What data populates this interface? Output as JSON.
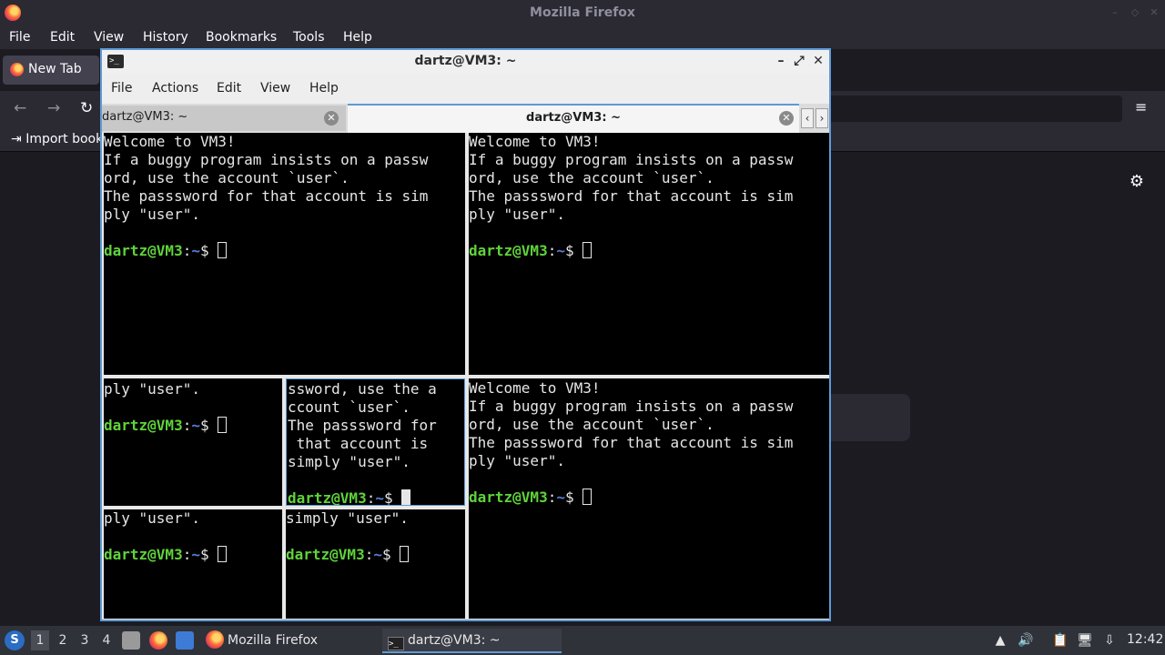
{
  "firefox": {
    "window_title": "Mozilla Firefox",
    "menus": [
      "File",
      "Edit",
      "View",
      "History",
      "Bookmarks",
      "Tools",
      "Help"
    ],
    "tab_label": "New Tab",
    "import_bookmarks": "Import book",
    "nav": {
      "back": "←",
      "forward": "→",
      "reload": "↻",
      "menu": "≡",
      "settings": "⚙"
    }
  },
  "terminal": {
    "title": "dartz@VM3: ~",
    "icon_text": ">_",
    "window_buttons": {
      "minimize": "–",
      "maximize": "⤢",
      "close": "✕"
    },
    "menus": [
      "File",
      "Actions",
      "Edit",
      "View",
      "Help"
    ],
    "tabs": [
      {
        "label": "dartz@VM3: ~",
        "active": false
      },
      {
        "label": "dartz@VM3: ~",
        "active": true
      }
    ],
    "tab_close": "⊗",
    "tab_scroll_left": "‹",
    "tab_scroll_right": "›",
    "prompt": {
      "user": "dartz@VM3",
      "sep": ":",
      "path": "~",
      "symbol": "$ "
    },
    "panes": [
      {
        "lines": [
          "Welcome to VM3!",
          "If a buggy program insists on a passw",
          "ord, use the account `user`.",
          "The passsword for that account is sim",
          "ply \"user\".",
          ""
        ],
        "cursor": "outline"
      },
      {
        "lines": [
          "Welcome to VM3!",
          "If a buggy program insists on a passw",
          "ord, use the account `user`.",
          "The passsword for that account is sim",
          "ply \"user\".",
          ""
        ],
        "cursor": "outline"
      },
      {
        "lines": [
          "ply \"user\".",
          ""
        ],
        "cursor": "outline"
      },
      {
        "lines": [
          "ssword, use the a",
          "ccount `user`.",
          "The passsword for",
          " that account is",
          "simply \"user\".",
          ""
        ],
        "cursor": "solid"
      },
      {
        "lines": [
          "Welcome to VM3!",
          "If a buggy program insists on a passw",
          "ord, use the account `user`.",
          "The passsword for that account is sim",
          "ply \"user\".",
          ""
        ],
        "cursor": "outline"
      },
      {
        "lines": [
          "ply \"user\".",
          ""
        ],
        "cursor": "outline"
      },
      {
        "lines": [
          "simply \"user\".",
          ""
        ],
        "cursor": "outline"
      }
    ]
  },
  "taskbar": {
    "start_glyph": "S",
    "workspaces": [
      "1",
      "2",
      "3",
      "4"
    ],
    "tasks": [
      "Mozilla Firefox",
      "dartz@VM3: ~"
    ],
    "task_icons": {
      "firefox": "firefox-icon",
      "terminal": ">_"
    },
    "tray": {
      "notifications": "▲",
      "volume": "🔊",
      "clipboard": "📋",
      "network": "🖥",
      "updates": "⇩"
    },
    "clock": "12:42"
  }
}
